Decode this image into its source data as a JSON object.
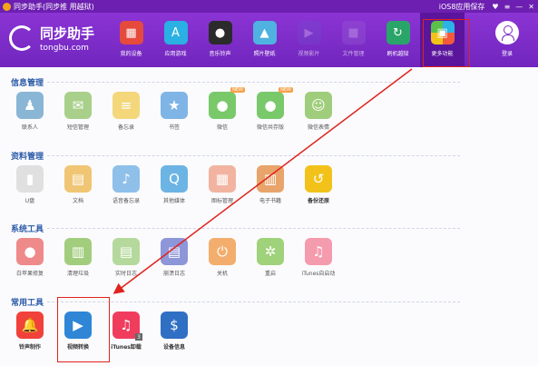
{
  "titlebar": {
    "title": "同步助手(同步推 用越狱)",
    "ios_link": "iOS8应用保存",
    "controls": [
      "♥",
      "≡",
      "—",
      "✕"
    ]
  },
  "logo": {
    "name": "同步助手",
    "url": "tongbu.com"
  },
  "nav": [
    {
      "label": "我的设备",
      "icon": "store-icon",
      "color": "#e54a3c",
      "glyph": "▦"
    },
    {
      "label": "应用游戏",
      "icon": "appstore-icon",
      "color": "#2ab0e3",
      "glyph": "A"
    },
    {
      "label": "音乐铃声",
      "icon": "vinyl-icon",
      "color": "#2b2b2b",
      "glyph": "●"
    },
    {
      "label": "照片壁纸",
      "icon": "photo-icon",
      "color": "#4fb2e0",
      "glyph": "▲"
    },
    {
      "label": "视频影片",
      "icon": "clapper-icon",
      "color": "#6a52c8",
      "glyph": "▶"
    },
    {
      "label": "文件管理",
      "icon": "folder-icon",
      "color": "#a06ad6",
      "glyph": "■"
    },
    {
      "label": "刷机越狱",
      "icon": "restore-icon",
      "color": "#2aa56a",
      "glyph": "↻"
    },
    {
      "label": "更多功能",
      "icon": "tiles-icon",
      "color": "#f2a51a",
      "glyph": "▣"
    }
  ],
  "login_label": "登录",
  "sections": [
    {
      "title": "信息管理",
      "items": [
        {
          "label": "联系人",
          "icon": "contacts-icon",
          "color": "#8ab6d6",
          "glyph": "♟"
        },
        {
          "label": "短信管理",
          "icon": "message-icon",
          "color": "#a8d08a",
          "glyph": "✉"
        },
        {
          "label": "备忘录",
          "icon": "notes-icon",
          "color": "#f3d77a",
          "glyph": "≡"
        },
        {
          "label": "书签",
          "icon": "bookmark-icon",
          "color": "#7fb4e6",
          "glyph": "★"
        },
        {
          "label": "微信",
          "icon": "wechat-icon",
          "color": "#79c96a",
          "glyph": "●",
          "badge": "NEW"
        },
        {
          "label": "微信共存版",
          "icon": "wechat-coexist-icon",
          "color": "#79c96a",
          "glyph": "●",
          "badge": "NEW"
        },
        {
          "label": "微信表情",
          "icon": "emoji-icon",
          "color": "#9fcd7b",
          "glyph": "☺"
        }
      ]
    },
    {
      "title": "资料管理",
      "items": [
        {
          "label": "U盘",
          "icon": "usb-icon",
          "color": "#e0e0e0",
          "glyph": "▮"
        },
        {
          "label": "文档",
          "icon": "document-icon",
          "color": "#f0c574",
          "glyph": "▤"
        },
        {
          "label": "语音备忘录",
          "icon": "microphone-icon",
          "color": "#8ec0ea",
          "glyph": "♪"
        },
        {
          "label": "其他媒体",
          "icon": "quicktime-icon",
          "color": "#6cb4e4",
          "glyph": "Q"
        },
        {
          "label": "图标管理",
          "icon": "grid-icon",
          "color": "#f2b4a0",
          "glyph": "▦"
        },
        {
          "label": "电子书籍",
          "icon": "book-icon",
          "color": "#e8a46a",
          "glyph": "▥"
        },
        {
          "label": "备份还原",
          "icon": "backup-icon",
          "color": "#f2c21a",
          "glyph": "↺",
          "bold": true
        }
      ]
    },
    {
      "title": "系统工具",
      "items": [
        {
          "label": "白苹果修复",
          "icon": "apple-icon",
          "color": "#ef8a8a",
          "glyph": "●"
        },
        {
          "label": "清理垃圾",
          "icon": "trash-icon",
          "color": "#a2cd7d",
          "glyph": "▥"
        },
        {
          "label": "实时日志",
          "icon": "log-icon",
          "color": "#b5d99c",
          "glyph": "▤"
        },
        {
          "label": "崩溃日志",
          "icon": "crash-icon",
          "color": "#8d96d9",
          "glyph": "▤"
        },
        {
          "label": "关机",
          "icon": "power-icon",
          "color": "#f3ae6d",
          "glyph": "⏻"
        },
        {
          "label": "重启",
          "icon": "restart-icon",
          "color": "#9fd27a",
          "glyph": "✲"
        },
        {
          "label": "iTunes自启动",
          "icon": "itunes-icon",
          "color": "#f59bae",
          "glyph": "♫"
        }
      ]
    },
    {
      "title": "常用工具",
      "items": [
        {
          "label": "铃声制作",
          "icon": "bell-icon",
          "color": "#f0413a",
          "glyph": "🔔",
          "bold": true
        },
        {
          "label": "视频转换",
          "icon": "video-convert-icon",
          "color": "#2f86d6",
          "glyph": "▶",
          "bold": true
        },
        {
          "label": "iTunes卸载",
          "icon": "itunes-uninstall-icon",
          "color": "#f03d5e",
          "glyph": "♫",
          "badge_num": "3",
          "bold": true
        },
        {
          "label": "设备信息",
          "icon": "device-info-icon",
          "color": "#2f6fc4",
          "glyph": "$",
          "bold": true
        }
      ]
    }
  ]
}
